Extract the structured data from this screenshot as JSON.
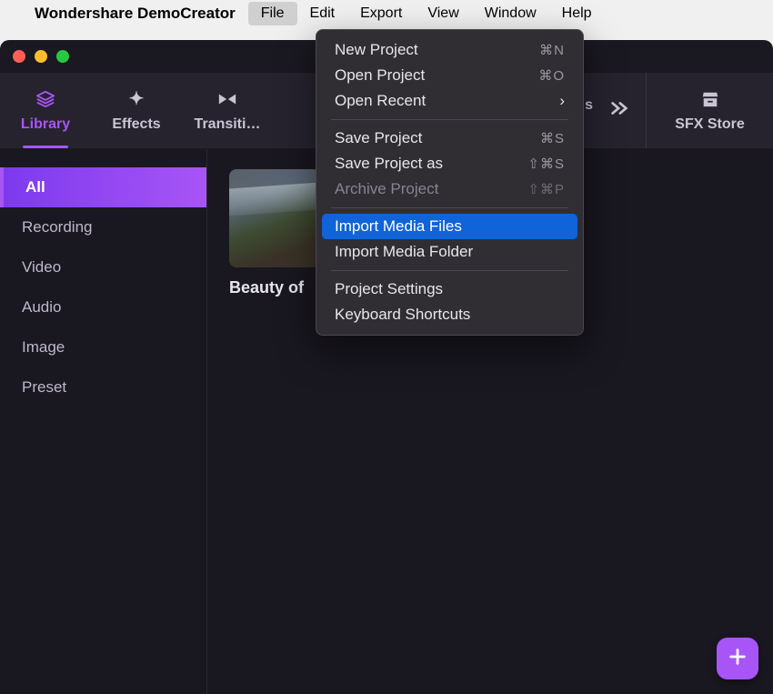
{
  "menubar": {
    "app_name": "Wondershare DemoCreator",
    "items": [
      "File",
      "Edit",
      "Export",
      "View",
      "Window",
      "Help"
    ],
    "open_index": 0
  },
  "file_menu": {
    "groups": [
      [
        {
          "label": "New Project",
          "shortcut": "⌘N"
        },
        {
          "label": "Open Project",
          "shortcut": "⌘O"
        },
        {
          "label": "Open Recent",
          "submenu": true
        }
      ],
      [
        {
          "label": "Save Project",
          "shortcut": "⌘S"
        },
        {
          "label": "Save Project as",
          "shortcut": "⇧⌘S"
        },
        {
          "label": "Archive Project",
          "shortcut": "⇧⌘P",
          "disabled": true
        }
      ],
      [
        {
          "label": "Import Media Files",
          "highlight": true
        },
        {
          "label": "Import Media Folder"
        }
      ],
      [
        {
          "label": "Project Settings"
        },
        {
          "label": "Keyboard Shortcuts"
        }
      ]
    ]
  },
  "tabs": {
    "items": [
      {
        "label": "Library",
        "icon": "layers-icon",
        "glyph": "✦"
      },
      {
        "label": "Effects",
        "icon": "sparkle-icon",
        "glyph": "✦"
      },
      {
        "label": "Transiti…",
        "icon": "bowtie-icon",
        "glyph": "⧓"
      }
    ],
    "active_index": 0,
    "truncated_tail": "s",
    "overflow_icon_name": "chevron-double-right-icon",
    "sfx_label": "SFX Store",
    "sfx_icon": "store-icon"
  },
  "sidebar": {
    "items": [
      "All",
      "Recording",
      "Video",
      "Audio",
      "Image",
      "Preset"
    ],
    "active_index": 0
  },
  "content": {
    "items": [
      {
        "label": "Beauty of"
      }
    ]
  },
  "fab": {
    "icon": "plus-icon"
  }
}
